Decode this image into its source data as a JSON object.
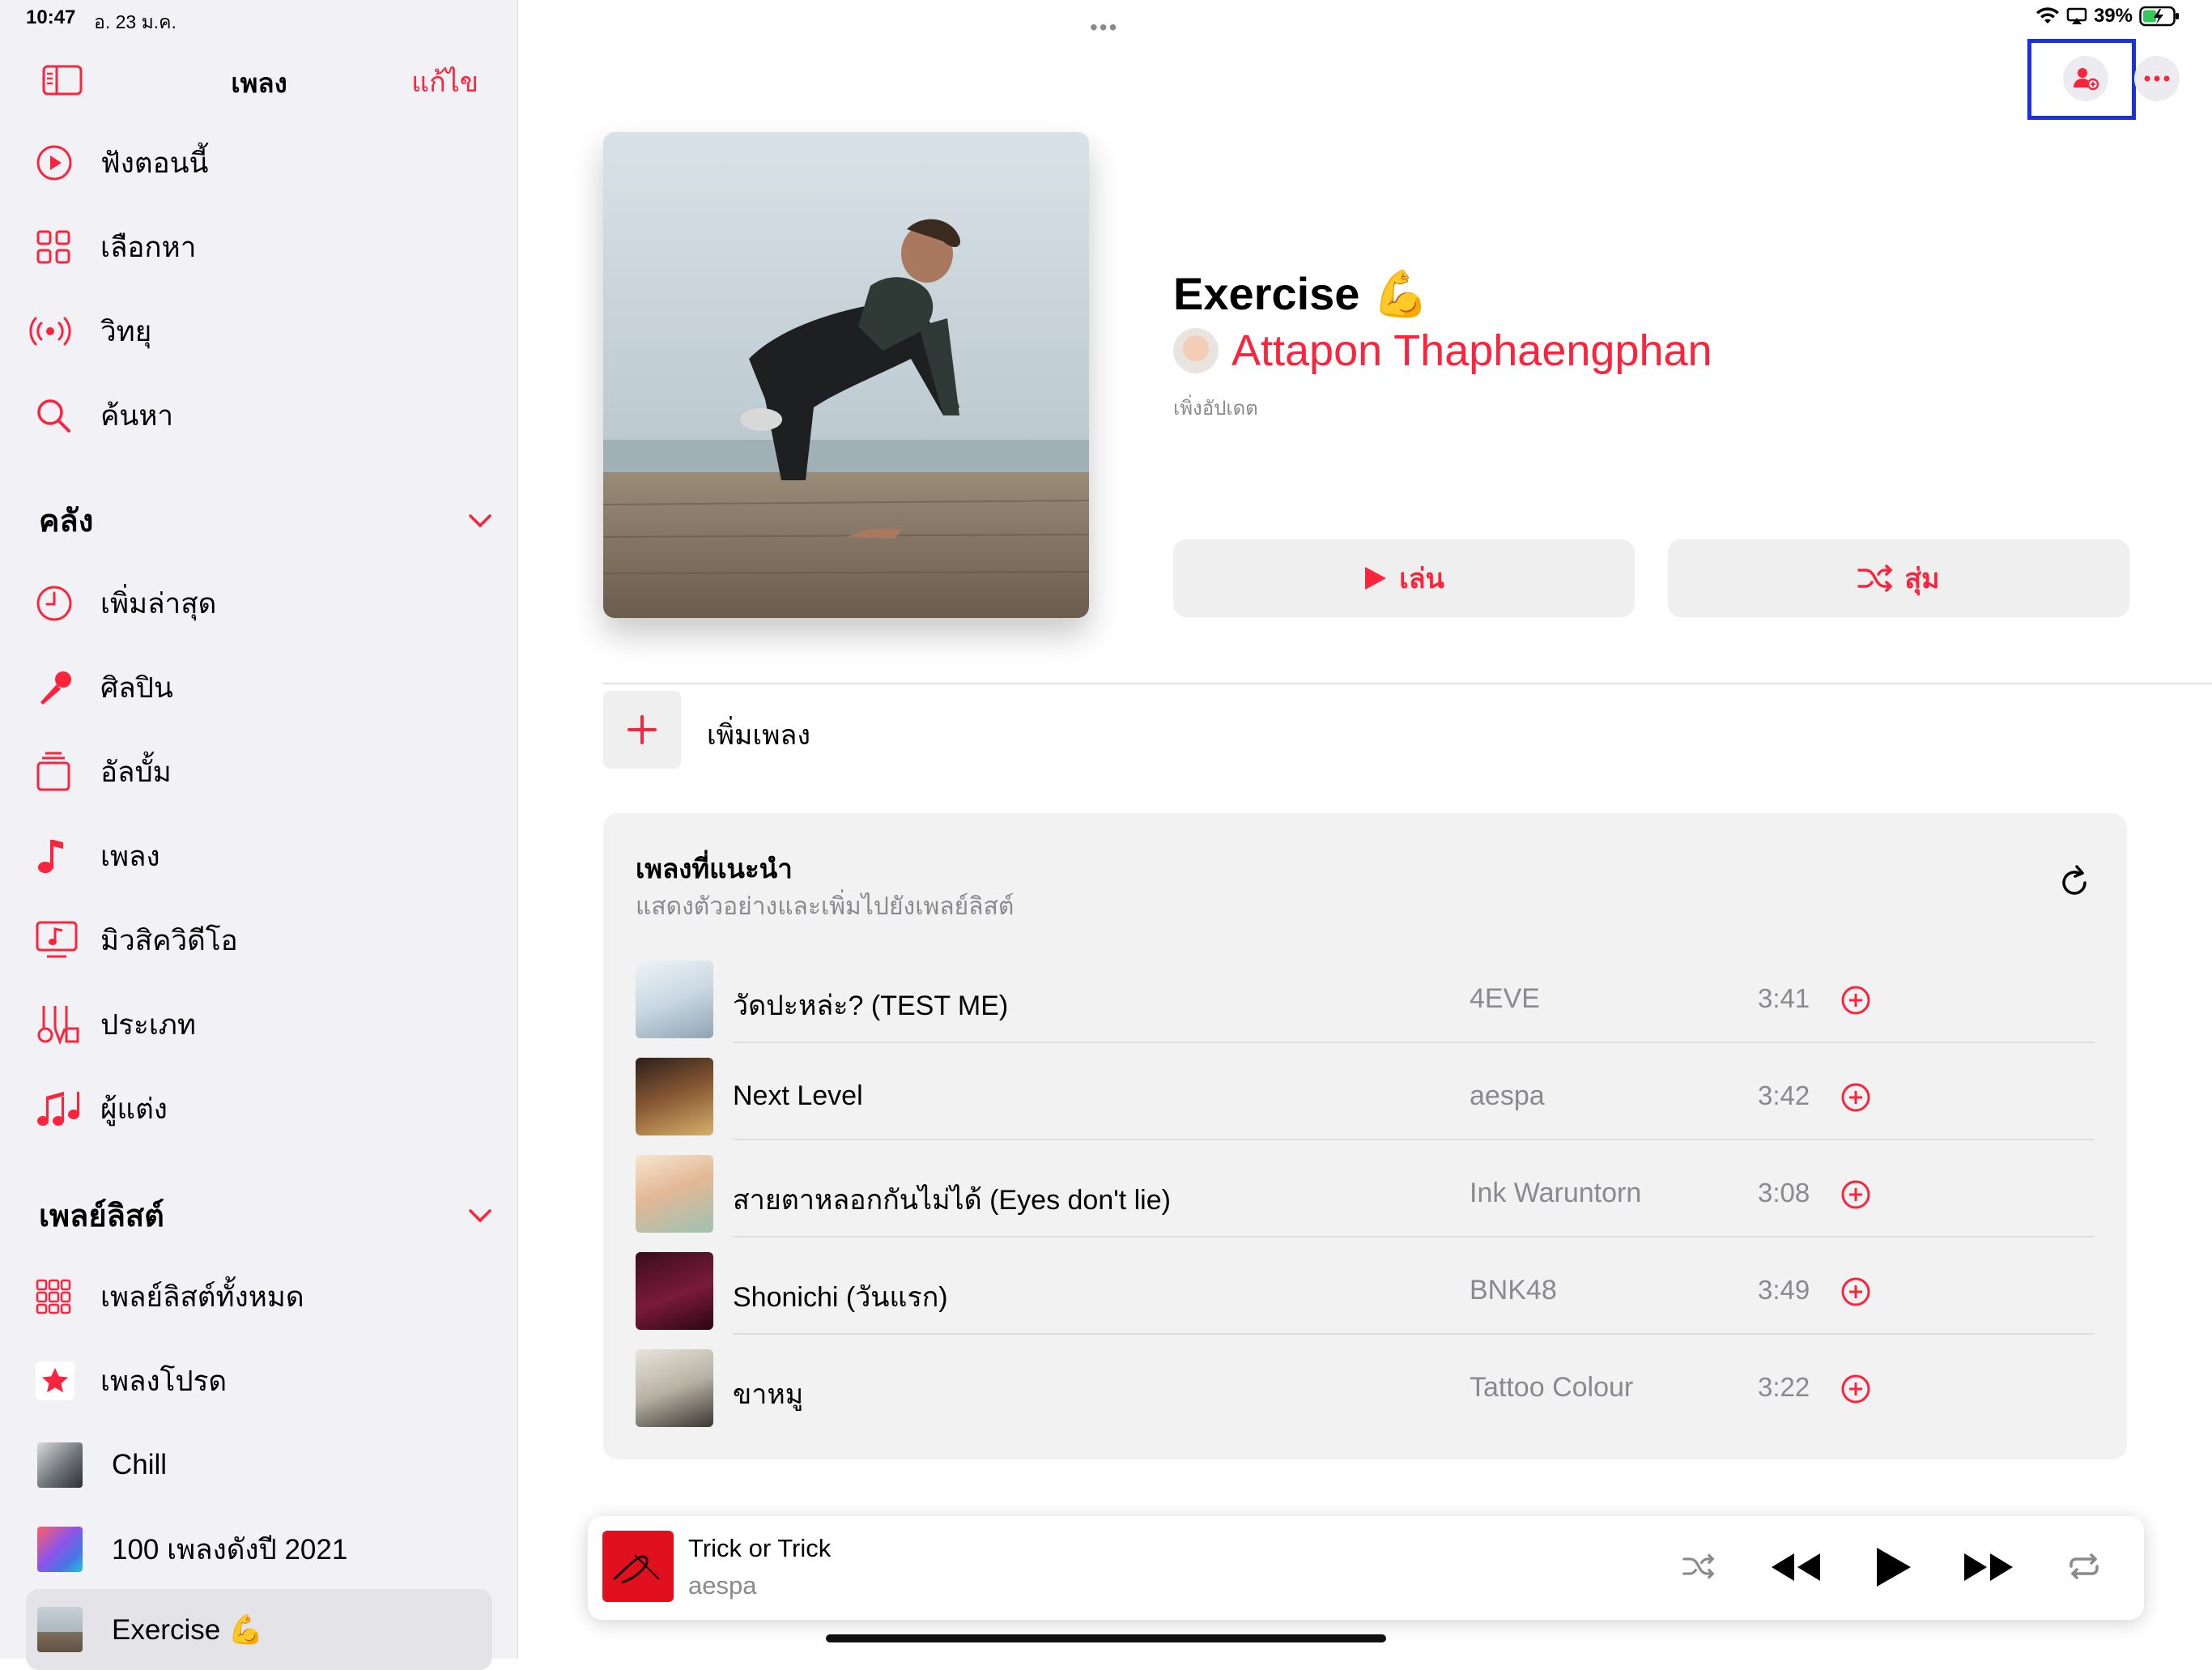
{
  "status": {
    "time": "10:47",
    "date": "อ. 23 ม.ค.",
    "battery": "39%"
  },
  "sidebar": {
    "title": "เพลง",
    "edit": "แก้ไข",
    "nav": [
      {
        "label": "ฟังตอนนี้",
        "icon": "play-circle-icon"
      },
      {
        "label": "เลือกหา",
        "icon": "grid-icon"
      },
      {
        "label": "วิทยุ",
        "icon": "radio-icon"
      },
      {
        "label": "ค้นหา",
        "icon": "search-icon"
      }
    ],
    "library_header": "คลัง",
    "library": [
      {
        "label": "เพิ่มล่าสุด",
        "icon": "clock-icon"
      },
      {
        "label": "ศิลปิน",
        "icon": "microphone-icon"
      },
      {
        "label": "อัลบั้ม",
        "icon": "album-icon"
      },
      {
        "label": "เพลง",
        "icon": "music-note-icon"
      },
      {
        "label": "มิวสิควิดีโอ",
        "icon": "music-video-icon"
      },
      {
        "label": "ประเภท",
        "icon": "genres-icon"
      },
      {
        "label": "ผู้แต่ง",
        "icon": "composers-icon"
      }
    ],
    "playlists_header": "เพลย์ลิสต์",
    "playlists": [
      {
        "label": "เพลย์ลิสต์ทั้งหมด",
        "icon": "all-playlists-icon"
      },
      {
        "label": "เพลงโปรด",
        "icon": "star-icon"
      },
      {
        "label": "Chill",
        "icon": "playlist-thumb"
      },
      {
        "label": "100 เพลงดังปี 2021",
        "icon": "playlist-thumb"
      },
      {
        "label": "Exercise 💪",
        "icon": "playlist-thumb"
      }
    ]
  },
  "playlist": {
    "title": "Exercise 💪",
    "owner": "Attapon Thaphaengphan",
    "updated": "เพิ่งอัปเดต",
    "play_label": "เล่น",
    "shuffle_label": "สุ่ม",
    "add_songs": "เพิ่มเพลง"
  },
  "recommended": {
    "title": "เพลงที่แนะนำ",
    "subtitle": "แสดงตัวอย่างและเพิ่มไปยังเพลย์ลิสต์",
    "tracks": [
      {
        "title": "วัดปะหล่ะ? (TEST ME)",
        "artist": "4EVE",
        "duration": "3:41"
      },
      {
        "title": "Next Level",
        "artist": "aespa",
        "duration": "3:42"
      },
      {
        "title": "สายตาหลอกกันไม่ได้ (Eyes don't lie)",
        "artist": "Ink Waruntorn",
        "duration": "3:08"
      },
      {
        "title": "Shonichi (วันแรก)",
        "artist": "BNK48",
        "duration": "3:49"
      },
      {
        "title": "ขาหมู",
        "artist": "Tattoo Colour",
        "duration": "3:22"
      }
    ]
  },
  "now_playing": {
    "title": "Trick or Trick",
    "artist": "aespa"
  },
  "colors": {
    "accent": "#fa243c",
    "highlight": "#1a33d8"
  }
}
